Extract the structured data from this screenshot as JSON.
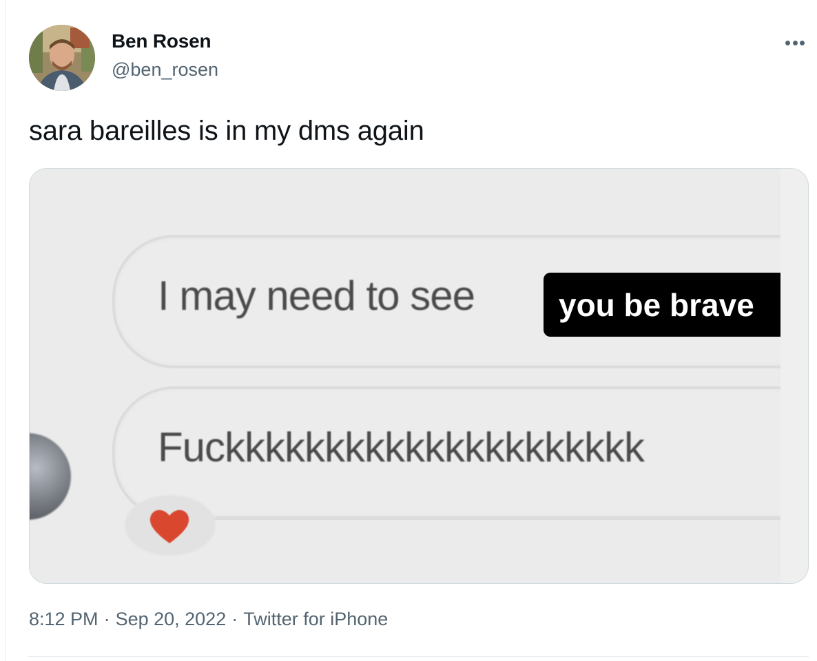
{
  "author": {
    "name": "Ben Rosen",
    "handle": "@ben_rosen"
  },
  "tweet": {
    "text": "sara bareilles is in my dms again"
  },
  "media": {
    "message_1": "I may need to see",
    "caption": "you be brave",
    "message_2": "Fuckkkkkkkkkkkkkkkkkkkkk",
    "reaction": "heart-icon"
  },
  "meta": {
    "time": "8:12 PM",
    "date": "Sep 20, 2022",
    "source": "Twitter for iPhone",
    "separator": "·"
  },
  "colors": {
    "text_primary": "#0f1419",
    "text_secondary": "#536471",
    "border": "#cfd9de",
    "caption_bg": "#000000",
    "heart": "#d9472f"
  },
  "icons": {
    "more": "more-options-icon"
  }
}
